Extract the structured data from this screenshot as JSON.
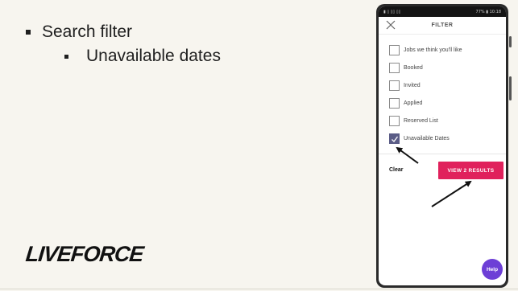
{
  "slide": {
    "bullet_1": "Search filter",
    "bullet_2": "Unavailable dates",
    "logo": "LIVEFORCE"
  },
  "phone": {
    "status_left": "▮ ▯ ▯▯ ▯▯",
    "status_right": "77% ▮ 10:18",
    "header_title": "FILTER",
    "options": [
      {
        "label": "Jobs we think you'll like",
        "checked": false
      },
      {
        "label": "Booked",
        "checked": false
      },
      {
        "label": "Invited",
        "checked": false
      },
      {
        "label": "Applied",
        "checked": false
      },
      {
        "label": "Reserved List",
        "checked": false
      },
      {
        "label": "Unavailable Dates",
        "checked": true
      }
    ],
    "clear_label": "Clear",
    "view_button_label": "VIEW 2 RESULTS",
    "help_label": "Help"
  },
  "colors": {
    "background": "#f7f5ef",
    "accent": "#e0215c",
    "checkbox_checked": "#5a5c86",
    "help": "#6d3fd6"
  }
}
